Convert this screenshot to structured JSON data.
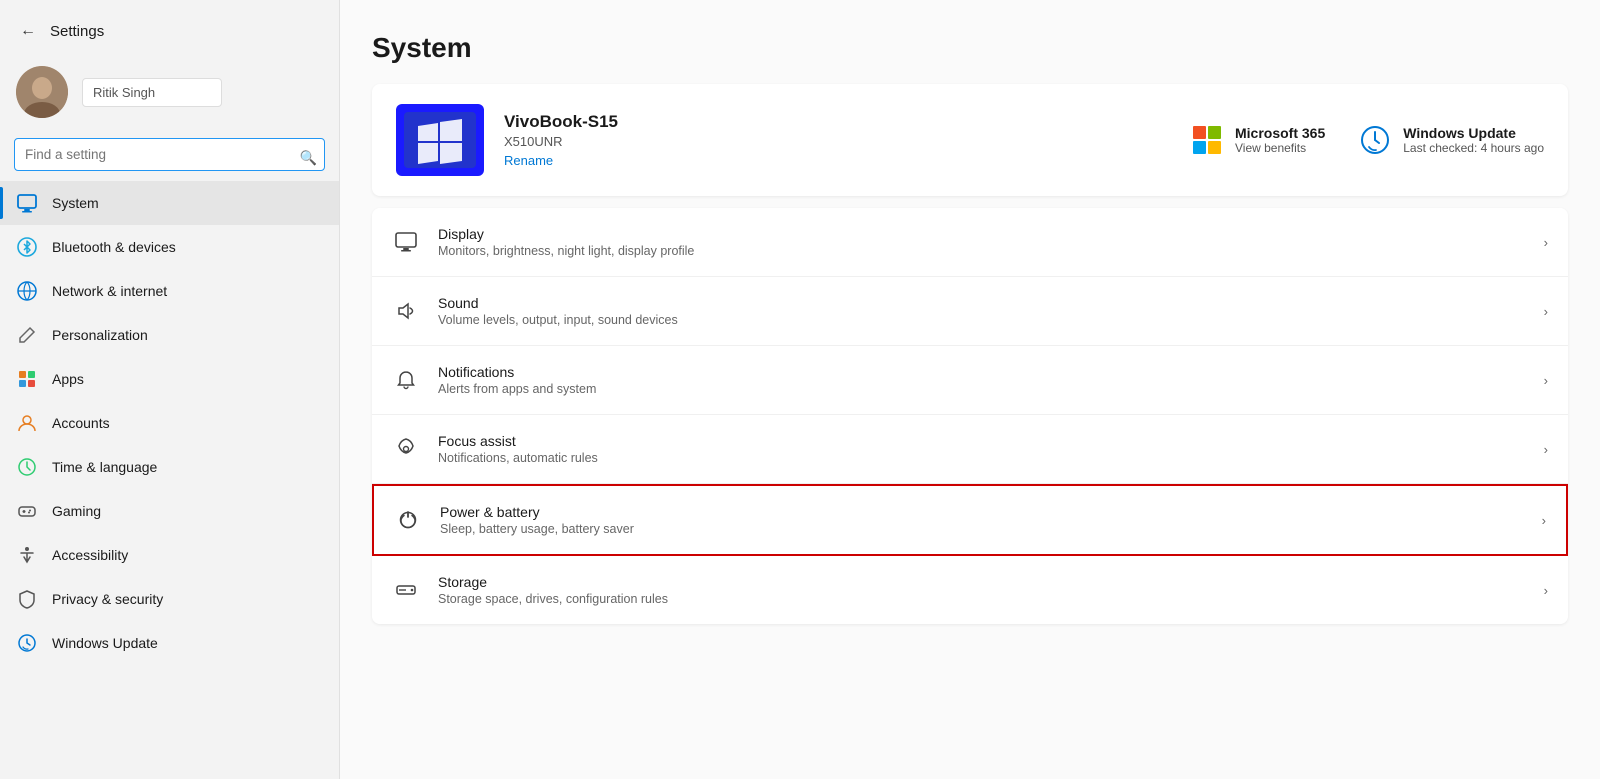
{
  "sidebar": {
    "back_btn": "←",
    "title": "Settings",
    "user": {
      "name": "Ritik Singh",
      "avatar_text": "👤"
    },
    "search": {
      "placeholder": "Find a setting",
      "icon": "🔍"
    },
    "nav_items": [
      {
        "id": "system",
        "label": "System",
        "icon": "🖥",
        "active": true
      },
      {
        "id": "bluetooth",
        "label": "Bluetooth & devices",
        "icon": "📶"
      },
      {
        "id": "network",
        "label": "Network & internet",
        "icon": "🌐"
      },
      {
        "id": "personalization",
        "label": "Personalization",
        "icon": "✏️"
      },
      {
        "id": "apps",
        "label": "Apps",
        "icon": "📦"
      },
      {
        "id": "accounts",
        "label": "Accounts",
        "icon": "👤"
      },
      {
        "id": "time",
        "label": "Time & language",
        "icon": "🌍"
      },
      {
        "id": "gaming",
        "label": "Gaming",
        "icon": "🎮"
      },
      {
        "id": "accessibility",
        "label": "Accessibility",
        "icon": "♿"
      },
      {
        "id": "privacy",
        "label": "Privacy & security",
        "icon": "🛡"
      },
      {
        "id": "update",
        "label": "Windows Update",
        "icon": "🔄"
      }
    ]
  },
  "main": {
    "page_title": "System",
    "device": {
      "name": "VivoBook-S15",
      "model": "X510UNR",
      "rename_label": "Rename"
    },
    "extras": [
      {
        "id": "ms365",
        "title": "Microsoft 365",
        "subtitle": "View benefits"
      },
      {
        "id": "winupdate",
        "title": "Windows Update",
        "subtitle": "Last checked: 4 hours ago"
      }
    ],
    "settings": [
      {
        "id": "display",
        "label": "Display",
        "desc": "Monitors, brightness, night light, display profile",
        "icon": "🖥",
        "highlighted": false
      },
      {
        "id": "sound",
        "label": "Sound",
        "desc": "Volume levels, output, input, sound devices",
        "icon": "🔊",
        "highlighted": false
      },
      {
        "id": "notifications",
        "label": "Notifications",
        "desc": "Alerts from apps and system",
        "icon": "🔔",
        "highlighted": false
      },
      {
        "id": "focus",
        "label": "Focus assist",
        "desc": "Notifications, automatic rules",
        "icon": "🌙",
        "highlighted": false
      },
      {
        "id": "power",
        "label": "Power & battery",
        "desc": "Sleep, battery usage, battery saver",
        "icon": "⏻",
        "highlighted": true
      },
      {
        "id": "storage",
        "label": "Storage",
        "desc": "Storage space, drives, configuration rules",
        "icon": "💾",
        "highlighted": false
      }
    ]
  }
}
